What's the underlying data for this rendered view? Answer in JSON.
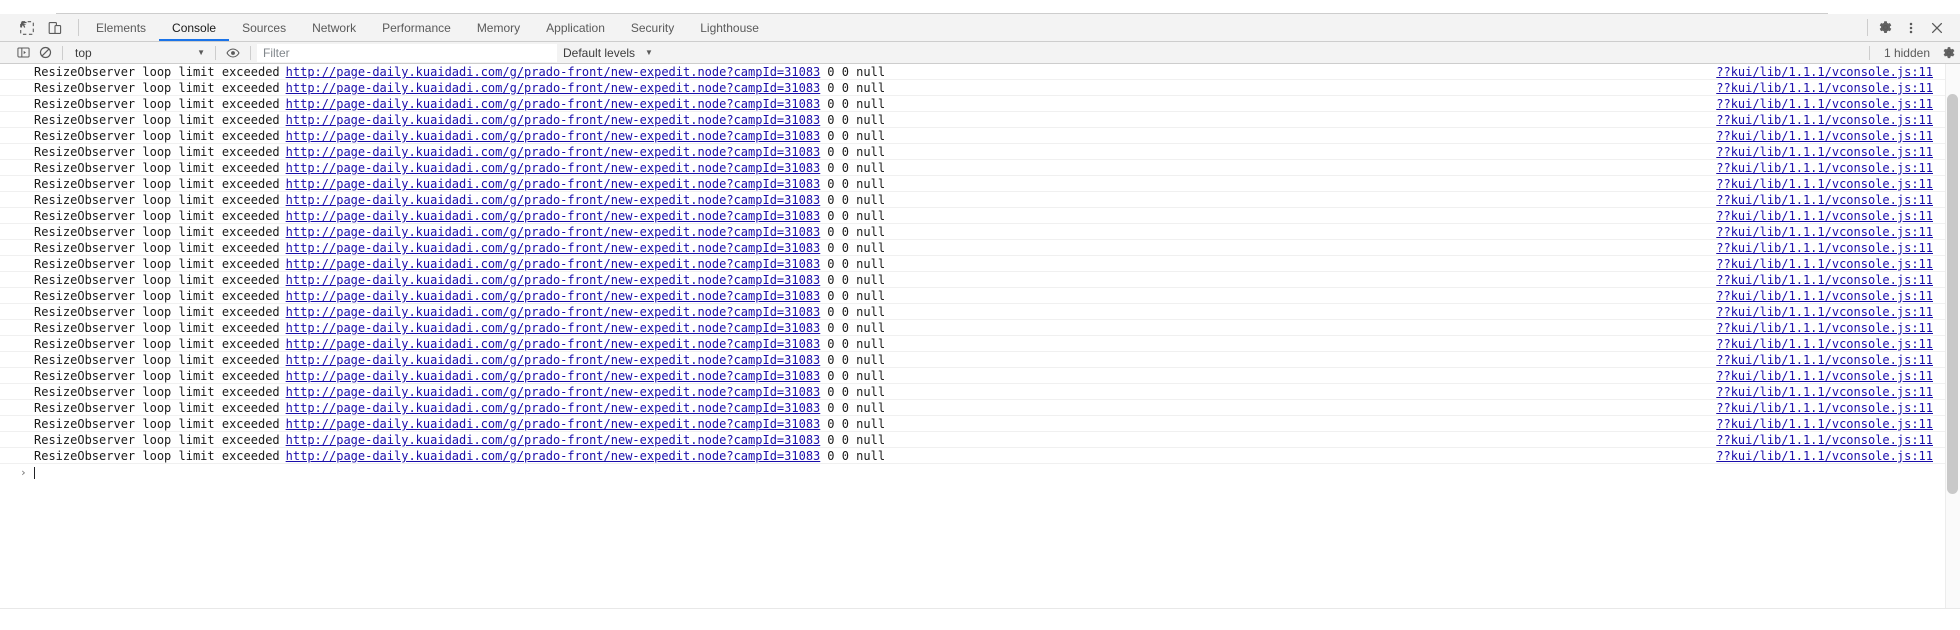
{
  "tabbar": {
    "inspect_icon": "inspect-element-icon",
    "device_icon": "device-toolbar-icon",
    "tabs": [
      {
        "label": "Elements",
        "active": false
      },
      {
        "label": "Console",
        "active": true
      },
      {
        "label": "Sources",
        "active": false
      },
      {
        "label": "Network",
        "active": false
      },
      {
        "label": "Performance",
        "active": false
      },
      {
        "label": "Memory",
        "active": false
      },
      {
        "label": "Application",
        "active": false
      },
      {
        "label": "Security",
        "active": false
      },
      {
        "label": "Lighthouse",
        "active": false
      }
    ],
    "settings_icon": "gear-icon",
    "more_icon": "more-vertical-icon",
    "close_icon": "close-icon"
  },
  "console_toolbar": {
    "sidebar_icon": "console-sidebar-icon",
    "clear_icon": "clear-console-icon",
    "context": "top",
    "context_caret": "▼",
    "eye_icon": "live-expression-icon",
    "filter_placeholder": "Filter",
    "filter_value": "",
    "levels_label": "Default levels",
    "levels_caret": "▼",
    "hidden_count": "1 hidden",
    "settings_icon": "console-settings-icon"
  },
  "console": {
    "message_text": "ResizeObserver loop limit exceeded",
    "message_url": "http://page-daily.kuaidadi.com/g/prado-front/new-expedit.node?campId=31083",
    "message_args": "0 0 null",
    "source_link": "??kui/lib/1.1.1/vconsole.js:11",
    "repeat_count": 25,
    "prompt_arrow": "›"
  },
  "colors": {
    "link": "#1a0dab",
    "accent": "#1a73e8",
    "toolbar_bg": "#f3f3f3",
    "text": "#1a1a1a"
  }
}
